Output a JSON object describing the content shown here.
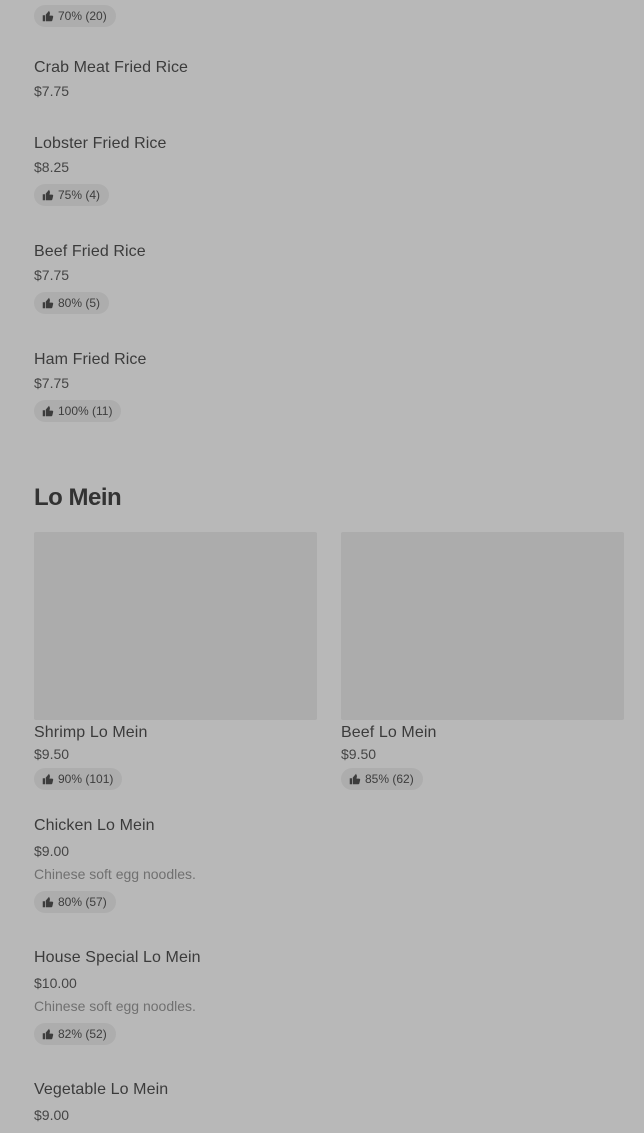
{
  "fried_rice": {
    "top_rating": "70% (20)",
    "items": [
      {
        "name": "Crab Meat Fried Rice",
        "price": "$7.75"
      },
      {
        "name": "Lobster Fried Rice",
        "price": "$8.25",
        "rating": "75% (4)"
      },
      {
        "name": "Beef Fried Rice",
        "price": "$7.75",
        "rating": "80% (5)"
      },
      {
        "name": "Ham Fried Rice",
        "price": "$7.75",
        "rating": "100% (11)"
      }
    ]
  },
  "lo_mein": {
    "title": "Lo Mein",
    "cards": [
      {
        "name": "Shrimp Lo Mein",
        "price": "$9.50",
        "rating": "90% (101)"
      },
      {
        "name": "Beef Lo Mein",
        "price": "$9.50",
        "rating": "85% (62)"
      }
    ],
    "items": [
      {
        "name": "Chicken Lo Mein",
        "price": "$9.00",
        "desc": "Chinese soft egg noodles.",
        "rating": "80% (57)"
      },
      {
        "name": "House Special Lo Mein",
        "price": "$10.00",
        "desc": "Chinese soft egg noodles.",
        "rating": "82% (52)"
      },
      {
        "name": "Vegetable Lo Mein",
        "price": "$9.00"
      }
    ]
  },
  "icons": {
    "rating": "thumbs-up-icon"
  }
}
